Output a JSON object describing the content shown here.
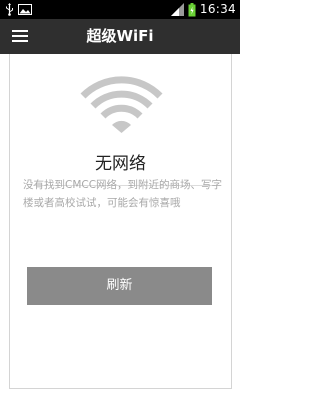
{
  "status_bar": {
    "time": "16:34",
    "icons": [
      "usb-icon",
      "image-icon",
      "signal-icon",
      "battery-icon"
    ]
  },
  "app_bar": {
    "title": "超级WiFi",
    "menu_icon": "menu-icon"
  },
  "main": {
    "status_icon": "wifi-icon",
    "status_title": "无网络",
    "message": "没有找到CMCC网络，到附近的商场、写字楼或者高校试试，可能会有惊喜哦",
    "refresh_label": "刷新"
  },
  "colors": {
    "status_bar_bg": "#000000",
    "title_bar_bg": "#2f2f2f",
    "wifi_icon": "#c7c7c7",
    "button_bg": "#8a8a8a",
    "message_text": "#a8a8a8"
  }
}
